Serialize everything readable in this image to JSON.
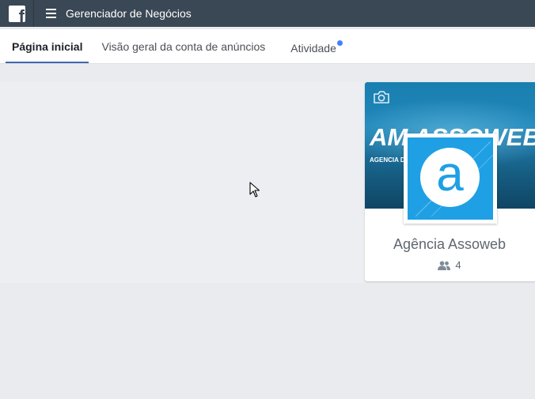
{
  "header": {
    "logo_icon": "facebook-logo",
    "logo_glyph": "f",
    "menu_icon": "hamburger-menu-icon",
    "title": "Gerenciador de Negócios",
    "background": "#3a4754"
  },
  "tabs": [
    {
      "label": "Página inicial",
      "active": true
    },
    {
      "label": "Visão geral da conta de anúncios",
      "active": false
    },
    {
      "label": "Atividade",
      "active": false,
      "has_notification": true
    }
  ],
  "business_card": {
    "cover_text": "AM ASSOWEB!",
    "cover_subtext": "AGENCIA DE",
    "cover_icon": "camera-icon",
    "logo_letter": "a",
    "name": "Agência Assoweb",
    "people_icon": "people-icon",
    "people_count": "4"
  },
  "colors": {
    "accent": "#4267b2",
    "notification": "#4080ff",
    "logo_blue": "#1fa0e4"
  }
}
